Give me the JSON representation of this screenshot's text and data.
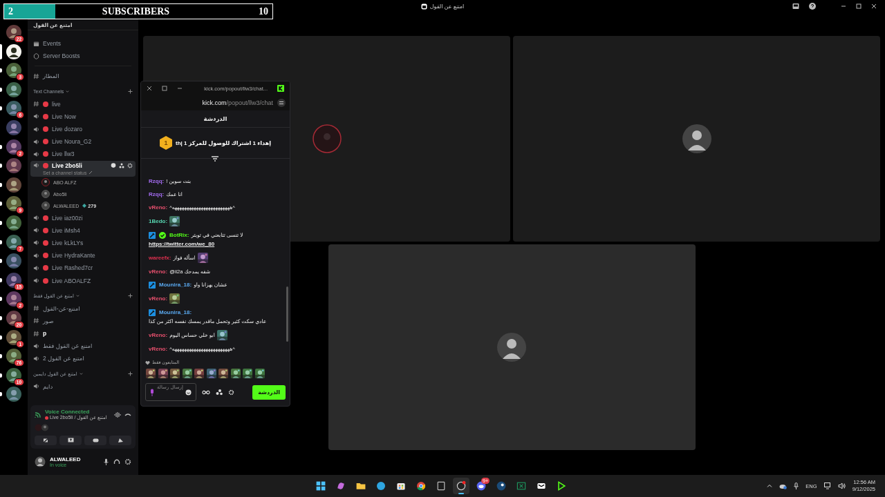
{
  "title_bar": {
    "title": "امتنع عن القول"
  },
  "subscriber_goal": {
    "current": "2",
    "label": "SUBSCRIBERS",
    "target": "10",
    "level": 0.19
  },
  "servers": [
    {
      "badge": "22",
      "selected": false,
      "unread": false
    },
    {
      "selected": true,
      "unread": false
    },
    {
      "badge": "3",
      "selected": false,
      "unread": true
    },
    {
      "selected": false,
      "unread": true
    },
    {
      "badge": "6",
      "selected": false,
      "unread": true
    },
    {
      "selected": false,
      "unread": false
    },
    {
      "badge": "2",
      "selected": false,
      "unread": true
    },
    {
      "selected": false,
      "unread": true
    },
    {
      "selected": false,
      "unread": true
    },
    {
      "badge": "9",
      "selected": false,
      "unread": true
    },
    {
      "selected": false,
      "unread": true
    },
    {
      "badge": "7",
      "selected": false,
      "unread": true
    },
    {
      "selected": false,
      "unread": true
    },
    {
      "badge": "15",
      "selected": false,
      "unread": true
    },
    {
      "badge": "2",
      "selected": false,
      "unread": true
    },
    {
      "badge": "20",
      "selected": false,
      "unread": true
    },
    {
      "badge": "1",
      "selected": false,
      "unread": true
    },
    {
      "badge": "76",
      "selected": false,
      "unread": true
    },
    {
      "badge": "10",
      "selected": false,
      "unread": true
    },
    {
      "selected": false,
      "unread": true
    }
  ],
  "sidebar": {
    "server_name": "امتنع عن القول",
    "items": [
      {
        "kind": "event",
        "label": "Events"
      },
      {
        "kind": "boost",
        "label": "Server Boosts"
      }
    ],
    "sections": [
      {
        "channels": [
          {
            "kind": "text",
            "name": "المطار",
            "live": false,
            "selected": false,
            "unread": false
          }
        ]
      },
      {
        "category": "Text Channels",
        "channels": [
          {
            "kind": "text",
            "name": "live",
            "live": true,
            "selected": false,
            "unread": false
          },
          {
            "kind": "voice",
            "name": "Live Now",
            "live": true,
            "selected": false,
            "unread": false
          },
          {
            "kind": "voice",
            "name": "Live dozaro",
            "live": true,
            "selected": false,
            "unread": false
          },
          {
            "kind": "voice",
            "name": "Live Noura_G2",
            "live": true,
            "selected": false,
            "unread": false
          },
          {
            "kind": "voice",
            "name": "Live llw3",
            "live": true,
            "selected": false,
            "unread": false
          },
          {
            "kind": "voice",
            "name": "Live 2bo5li",
            "live": true,
            "selected": true,
            "unread": false,
            "status": "Set a channel status",
            "members": [
              {
                "name": "ABO ALFZ"
              },
              {
                "name": "Abo5li"
              },
              {
                "name": "ALWALEED",
                "badge": "279"
              }
            ]
          },
          {
            "kind": "voice",
            "name": "Live iaz00zi",
            "live": true,
            "selected": false,
            "unread": false
          },
          {
            "kind": "voice",
            "name": "Live iMsh4",
            "live": true,
            "selected": false,
            "unread": false
          },
          {
            "kind": "voice",
            "name": "Live kLkLYs",
            "live": true,
            "selected": false,
            "unread": false
          },
          {
            "kind": "voice",
            "name": "Live HydraKante",
            "live": true,
            "selected": false,
            "unread": false
          },
          {
            "kind": "voice",
            "name": "Live Rashed7cr",
            "live": true,
            "selected": false,
            "unread": false
          },
          {
            "kind": "voice",
            "name": "Live ABOALFZ",
            "live": true,
            "selected": false,
            "unread": false
          }
        ]
      },
      {
        "category": "امتنع عن القول فقط",
        "channels": [
          {
            "kind": "text",
            "name": "امتنع-عن-القول",
            "live": false,
            "selected": false,
            "unread": false
          },
          {
            "kind": "text",
            "name": "صور",
            "live": false,
            "selected": false,
            "unread": false
          },
          {
            "kind": "text",
            "name": "p",
            "live": false,
            "selected": false,
            "unread": true
          },
          {
            "kind": "voice",
            "name": "امتنع عن القول فقط",
            "live": false,
            "selected": false,
            "unread": false
          },
          {
            "kind": "voice",
            "name": "امتنع عن القول 2",
            "live": false,
            "selected": false,
            "unread": false
          }
        ]
      },
      {
        "category": "امتنع عن القول دايمين",
        "channels": [
          {
            "kind": "voice",
            "name": "دايم",
            "live": false,
            "selected": false,
            "unread": false
          }
        ]
      }
    ]
  },
  "voice_panel": {
    "status": "Voice Connected",
    "channel": "Live 2bo5li / امتنع عن القول"
  },
  "user_panel": {
    "name": "ALWALEED",
    "status": "In voice"
  },
  "stage": {
    "tiles": [
      {
        "kind": "ring_avatar"
      },
      {
        "kind": "avatar"
      },
      {
        "kind": "avatar"
      }
    ]
  },
  "chat_window": {
    "title": "kick.com/popout/llw3/chat...",
    "url_domain": "kick.com",
    "url_path": "/popout/llw3/chat",
    "header": "الدردشة",
    "pinned": {
      "rank": "1",
      "text": "إهداء 1 اشتراك للوصول للمركز 1 |th"
    },
    "messages": [
      {
        "user": "Rzqq:",
        "color": "#a36bf0",
        "moderator": false,
        "verified": false,
        "emote": false,
        "text": "بنت سوين !"
      },
      {
        "user": "Rzqq:",
        "color": "#a36bf0",
        "moderator": false,
        "verified": false,
        "emote": false,
        "text": "انا عمك"
      },
      {
        "user": "vReno:",
        "color": "#e8506e",
        "moderator": false,
        "verified": false,
        "emote": false,
        "text": "^ههههههههههههههههههههههههه^"
      },
      {
        "user": "1Bedo:",
        "color": "#57d6b0",
        "moderator": false,
        "verified": false,
        "emote": true
      },
      {
        "user": "BotRix:",
        "color": "#53fc18",
        "moderator": true,
        "verified": true,
        "emote": false,
        "text": "لا تنسى تتابعني في تويتر",
        "link": "https://twitter.com/we_80"
      },
      {
        "user": "wareefx:",
        "color": "#e0304f",
        "moderator": false,
        "verified": false,
        "emote": true,
        "text": "اسأله فواز"
      },
      {
        "user": "vReno:",
        "color": "#e8506e",
        "moderator": false,
        "verified": false,
        "emote": false,
        "text": "@ii2a شفه يمدحك"
      },
      {
        "user": "Mounira_18:",
        "color": "#5aa9f0",
        "moderator": true,
        "verified": false,
        "emote": false,
        "text": "عشان يهزانا واو"
      },
      {
        "user": "vReno:",
        "color": "#e8506e",
        "moderator": false,
        "verified": false,
        "emote": true
      },
      {
        "user": "Mounira_18:",
        "color": "#5aa9f0",
        "moderator": true,
        "verified": false,
        "emote": false,
        "text": "عادي سكت كثير وتحمل ماقدر يمسك نفسه اكثر من كذا"
      },
      {
        "user": "vReno:",
        "color": "#e8506e",
        "moderator": false,
        "verified": false,
        "emote": true,
        "text": "ابو خلي حساس اليوم"
      },
      {
        "user": "vReno:",
        "color": "#e8506e",
        "moderator": false,
        "verified": false,
        "emote": false,
        "text": "^ههههههههههههههههههههههههه^"
      }
    ],
    "followers_only": "المتابعون فقط",
    "input": {
      "placeholder": "إرسال رسالة"
    },
    "send_button": "الدردشة"
  },
  "taskbar": {
    "apps": [
      {
        "kind": "start",
        "active": false
      },
      {
        "kind": "copilot",
        "active": false
      },
      {
        "kind": "folder",
        "active": false
      },
      {
        "kind": "edge",
        "active": false
      },
      {
        "kind": "store",
        "active": false
      },
      {
        "kind": "chrome",
        "active": false
      },
      {
        "kind": "calculator",
        "active": false
      },
      {
        "kind": "recorder",
        "active": true
      },
      {
        "kind": "discord",
        "active": false,
        "badge": "9+"
      },
      {
        "kind": "steam",
        "active": false
      },
      {
        "kind": "sheet",
        "active": false
      },
      {
        "kind": "editor",
        "active": false
      },
      {
        "kind": "kick",
        "active": false
      }
    ],
    "language": "ENG",
    "time": "12:56 AM",
    "date": "9/12/2025"
  }
}
